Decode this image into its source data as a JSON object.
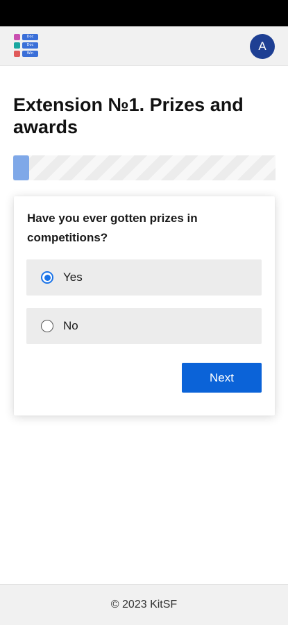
{
  "header": {
    "logo_items": [
      {
        "color": "#c94fb0",
        "label": "Doc"
      },
      {
        "color": "#1aa7a0",
        "label": "Doc"
      },
      {
        "color": "#e05a5a",
        "label": "Win"
      }
    ],
    "avatar_letter": "A",
    "avatar_color": "#1e3f93"
  },
  "page": {
    "title": "Extension №1. Prizes and awards"
  },
  "progress": {
    "fraction": 0.015,
    "fill_color": "#7fa8e8"
  },
  "question": {
    "text": "Have you ever gotten prizes in competitions?",
    "options": [
      {
        "label": "Yes",
        "selected": true
      },
      {
        "label": "No",
        "selected": false
      }
    ],
    "next_label": "Next",
    "accent_color": "#0b63d8"
  },
  "footer": {
    "text": "© 2023 KitSF"
  }
}
